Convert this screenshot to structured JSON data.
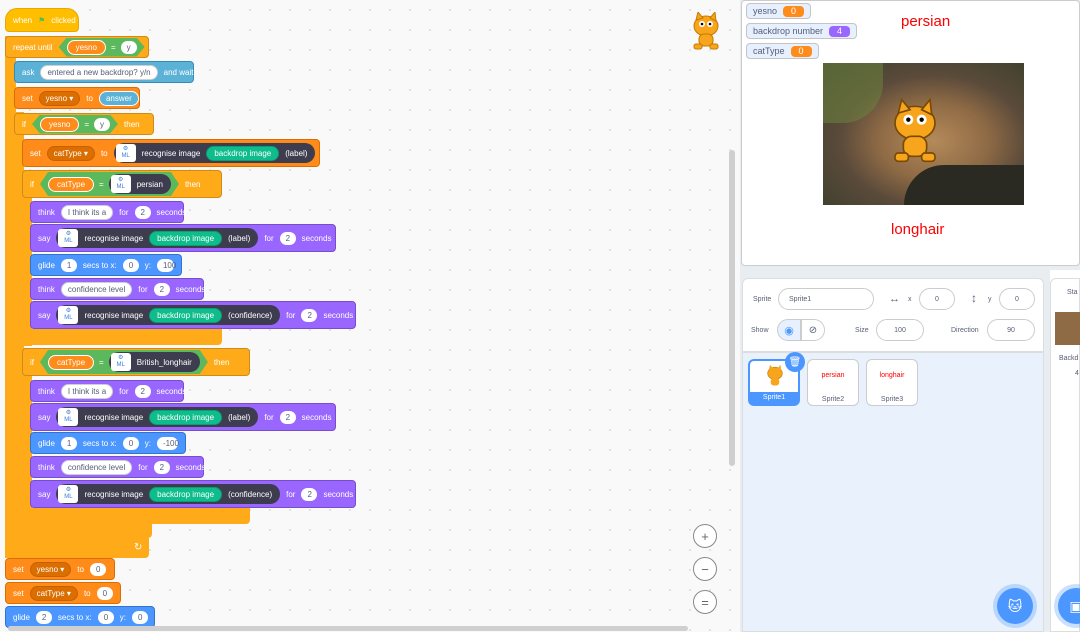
{
  "code": {
    "when_clicked": {
      "when": "when",
      "clicked": "clicked"
    },
    "repeat": {
      "label": "repeat until",
      "var": "yesno",
      "eq": "=",
      "val": "y"
    },
    "ask": {
      "label": "ask",
      "text": "entered a new backdrop? y/n",
      "wait": "and wait"
    },
    "set_yesno": {
      "label": "set",
      "var": "yesno ▾",
      "to": "to",
      "val": "answer"
    },
    "if1": {
      "label": "if",
      "var": "yesno",
      "eq": "=",
      "val": "y",
      "then": "then"
    },
    "set_cattype": {
      "label": "set",
      "var": "catType ▾",
      "to": "to",
      "rec": "recognise image",
      "bd": "backdrop image",
      "lab": "(label)"
    },
    "if2": {
      "label": "if",
      "var": "catType",
      "eq": "=",
      "val": "persian",
      "then": "then"
    },
    "think1": {
      "label": "think",
      "text": "I think its a",
      "for": "for",
      "n": "2",
      "secs": "seconds"
    },
    "say1": {
      "label": "say",
      "rec": "recognise image",
      "bd": "backdrop image",
      "lab": "(label)",
      "for": "for",
      "n": "2",
      "secs": "seconds"
    },
    "glide1": {
      "label": "glide",
      "n": "1",
      "secs": "secs to x:",
      "x": "0",
      "y": "y:",
      "yv": "100"
    },
    "think2": {
      "label": "think",
      "text": "confidence level",
      "for": "for",
      "n": "2",
      "secs": "seconds"
    },
    "say2": {
      "label": "say",
      "rec": "recognise image",
      "bd": "backdrop image",
      "lab": "(confidence)",
      "for": "for",
      "n": "2",
      "secs": "seconds"
    },
    "if3": {
      "label": "if",
      "var": "catType",
      "eq": "=",
      "val": "British_longhair",
      "then": "then"
    },
    "think3": {
      "label": "think",
      "text": "I think its a",
      "for": "for",
      "n": "2",
      "secs": "seconds"
    },
    "say3": {
      "label": "say",
      "rec": "recognise image",
      "bd": "backdrop image",
      "lab": "(label)",
      "for": "for",
      "n": "2",
      "secs": "seconds"
    },
    "glide2": {
      "label": "glide",
      "n": "1",
      "secs": "secs to x:",
      "x": "0",
      "y": "y:",
      "yv": "-100"
    },
    "think4": {
      "label": "think",
      "text": "confidence level",
      "for": "for",
      "n": "2",
      "secs": "seconds"
    },
    "say4": {
      "label": "say",
      "rec": "recognise image",
      "bd": "backdrop image",
      "lab": "(confidence)",
      "for": "for",
      "n": "2",
      "secs": "seconds"
    },
    "set3": {
      "label": "set",
      "var": "yesno ▾",
      "to": "to",
      "val": "0"
    },
    "set4": {
      "label": "set",
      "var": "catType ▾",
      "to": "to",
      "val": "0"
    },
    "glide3": {
      "label": "glide",
      "n": "2",
      "secs": "secs to x:",
      "x": "0",
      "y": "y:",
      "yv": "0"
    },
    "ml_badge": "ML"
  },
  "zoom": {
    "in": "+",
    "out": "−",
    "reset": "="
  },
  "stage": {
    "monitors": [
      {
        "name": "yesno",
        "value": "0",
        "color": "#ff8c1a"
      },
      {
        "name": "backdrop number",
        "value": "4",
        "color": "#9966ff"
      },
      {
        "name": "catType",
        "value": "0",
        "color": "#ff8c1a"
      }
    ],
    "text_top": "persian",
    "text_bottom": "longhair"
  },
  "sprite_info": {
    "sprite_label": "Sprite",
    "sprite_name": "Sprite1",
    "x_label": "x",
    "x_val": "0",
    "y_label": "y",
    "y_val": "0",
    "show_label": "Show",
    "size_label": "Size",
    "size_val": "100",
    "direction_label": "Direction",
    "direction_val": "90"
  },
  "sprites": [
    {
      "name": "Sprite1",
      "label": ""
    },
    {
      "name": "Sprite2",
      "label": "persian"
    },
    {
      "name": "Sprite3",
      "label": "longhair"
    }
  ],
  "stage_col": {
    "title": "Sta",
    "backdrops": "Backd",
    "count": "4"
  }
}
